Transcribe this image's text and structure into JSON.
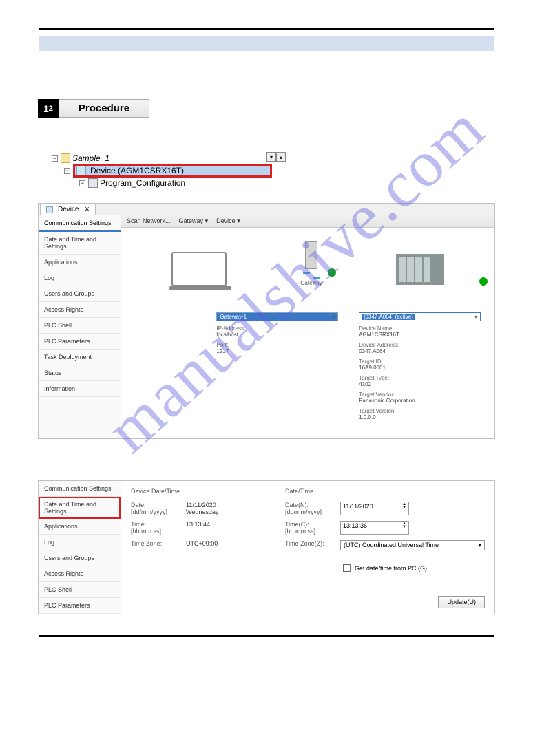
{
  "procedure": {
    "num": "1",
    "sub": "2",
    "title": "Procedure"
  },
  "tree": {
    "root": "Sample_1",
    "device": "Device (AGM1CSRX16T)",
    "prog": "Program_Configuration"
  },
  "tab": {
    "label": "Device"
  },
  "toolbar": {
    "scan": "Scan Network...",
    "gateway": "Gateway",
    "device": "Device"
  },
  "sidenav": {
    "items": [
      "Communication Settings",
      "Date and Time and Settings",
      "Applications",
      "Log",
      "Users and Groups",
      "Access Rights",
      "PLC Shell",
      "PLC Parameters",
      "Task Deployment",
      "Status",
      "Information"
    ]
  },
  "diagram": {
    "gateway_label": "Gateway"
  },
  "gw_info": {
    "select": "Gateway-1",
    "ip_lbl": "IP-Address:",
    "ip": "localhost",
    "port_lbl": "Port:",
    "port": "1217"
  },
  "dev_info": {
    "select": "[0347.A064] (active)",
    "name_lbl": "Device Name:",
    "name": "AGM1CSRX16T",
    "addr_lbl": "Device Address:",
    "addr": "0347.A064",
    "tid_lbl": "Target ID:",
    "tid": "16A9 0001",
    "ttype_lbl": "Target Type:",
    "ttype": "4102",
    "tvendor_lbl": "Target Vendor:",
    "tvendor": "Panasonic Corporation",
    "tver_lbl": "Target Version:",
    "tver": "1.0.0.0"
  },
  "panel2": {
    "device_dt_title": "Device Date/Time",
    "dt_title": "Date/Time",
    "date_lbl": "Date:",
    "date_fmt": "[dd/mm/yyyy]",
    "date_val": "11/11/2020",
    "day": "Wednesday",
    "time_lbl": "Time:",
    "time_fmt": "[hh:mm:ss]",
    "time_val": "13:13:44",
    "tz_lbl": "Time Zone:",
    "tz_val": "UTC+09:00",
    "date2_lbl": "Date(N):",
    "date2_val": "11/11/2020",
    "time2_lbl": "Time(C):",
    "time2_val": "13:13:36",
    "tz2_lbl": "Time Zone(Z):",
    "tz2_val": "(UTC) Coordinated Universal Time",
    "cb_label": "Get date/time from PC (G)",
    "update": "Update(U)"
  },
  "watermark": "manualshive.com"
}
